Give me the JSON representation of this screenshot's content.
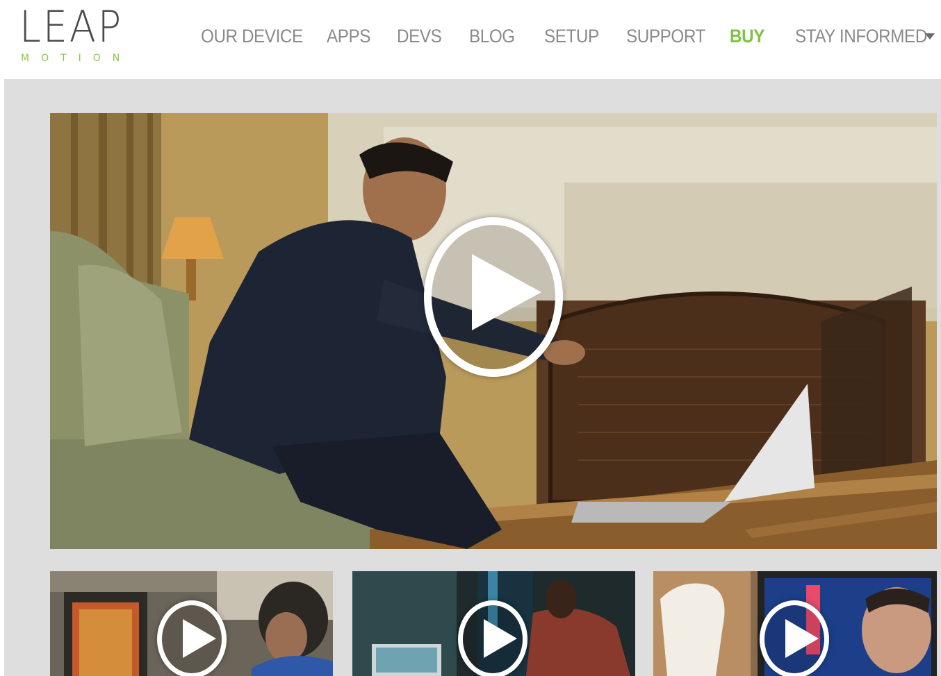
{
  "brand": {
    "logo_word": "LEAP",
    "logo_sub": "MOTION",
    "accent_color": "#7cc243"
  },
  "nav": {
    "items": [
      {
        "label": "OUR DEVICE"
      },
      {
        "label": "APPS"
      },
      {
        "label": "DEVS"
      },
      {
        "label": "BLOG"
      },
      {
        "label": "SETUP"
      },
      {
        "label": "SUPPORT"
      },
      {
        "label": "BUY"
      },
      {
        "label": "STAY INFORMED"
      }
    ],
    "dropdown_icon": "caret-down-icon"
  },
  "videos": {
    "play_icon": "play-icon",
    "hero": {
      "description": "man sitting on couch gesturing at laptop near fireplace"
    },
    "thumbnails": [
      {
        "description": "person playing game on monitor"
      },
      {
        "description": "person at desk with laptop in dark room"
      },
      {
        "description": "fist in front of screen with face"
      }
    ]
  }
}
